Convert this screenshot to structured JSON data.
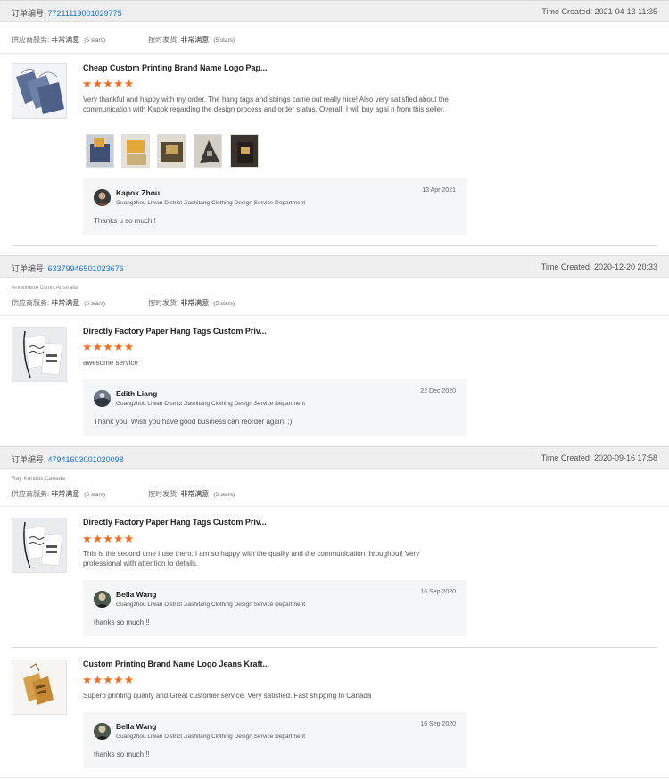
{
  "order_id_label": "订单编号:",
  "created_label": "Time Created:",
  "supplier_label": "供应商服务:",
  "shipping_label": "按时发货:",
  "orders": [
    {
      "id": "77211119001029775",
      "time": "2021-04-13 11:35",
      "buyer": "",
      "supplier_value": "非常满意",
      "supplier_stars": "(5 stars)",
      "shipping_value": "非常满意",
      "shipping_stars": "(5 stars)",
      "items": [
        {
          "title": "Cheap Custom Printing Brand Name Logo Pap...",
          "stars": "★★★★★",
          "review": "Very thankful and happy with my order. The hang tags and strings came out really nice! Also very satisfied about the communication with Kapok regarding the design process and order status. Overall, I will buy agai n from this seller.",
          "reply": {
            "name": "Kapok Zhou",
            "dept": "Guangzhou Liwan District Jiashitang Clothing Design Service Department",
            "date": "13 Apr 2021",
            "message": "Thanks u so much !"
          }
        }
      ]
    },
    {
      "id": "63379946501023676",
      "time": "2020-12-20 20:33",
      "buyer": "Antwinette Dunn,Australia",
      "supplier_value": "非常满意",
      "supplier_stars": "(5 stars)",
      "shipping_value": "非常满意",
      "shipping_stars": "(5 stars)",
      "items": [
        {
          "title": "Directly Factory Paper Hang Tags Custom Priv...",
          "stars": "★★★★★",
          "review": "awesome service",
          "reply": {
            "name": "Edith Liang",
            "dept": "Guangzhou Liwan District Jiashitang Clothing Design Service Department",
            "date": "22 Dec 2020",
            "message": "Thank you! Wish you have  good business can reorder again.  :)"
          }
        }
      ]
    },
    {
      "id": "47941603001020098",
      "time": "2020-09-16 17:58",
      "buyer": "Ray Kondos,Canada",
      "supplier_value": "非常满意",
      "supplier_stars": "(5 stars)",
      "shipping_value": "非常满意",
      "shipping_stars": "(5 stars)",
      "items": [
        {
          "title": "Directly Factory Paper Hang Tags Custom Priv...",
          "stars": "★★★★★",
          "review": "This is the second time I use them. I am so happy with the quality and the communication throughout! Very professional with attention to details.",
          "reply": {
            "name": "Bella Wang",
            "dept": "Guangzhou Liwan District Jiashitang Clothing Design Service Department",
            "date": "16 Sep 2020",
            "message": "thanks so much !!"
          }
        },
        {
          "title": "Custom Printing Brand Name Logo Jeans Kraft...",
          "stars": "★★★★★",
          "review": "Superb printing quality and Great customer service. Very satisfied. Fast shipping to Canada",
          "reply": {
            "name": "Bella Wang",
            "dept": "Guangzhou Liwan District Jiashitang Clothing Design Service Department",
            "date": "16 Sep 2020",
            "message": "thanks so much !!"
          }
        }
      ]
    }
  ],
  "colors": {
    "accent_link": "#1a73c8",
    "star": "#f26b1d",
    "header_bg": "#efefef",
    "reply_bg": "#f5f6f8"
  },
  "icons": [
    "star-icon",
    "avatar"
  ]
}
